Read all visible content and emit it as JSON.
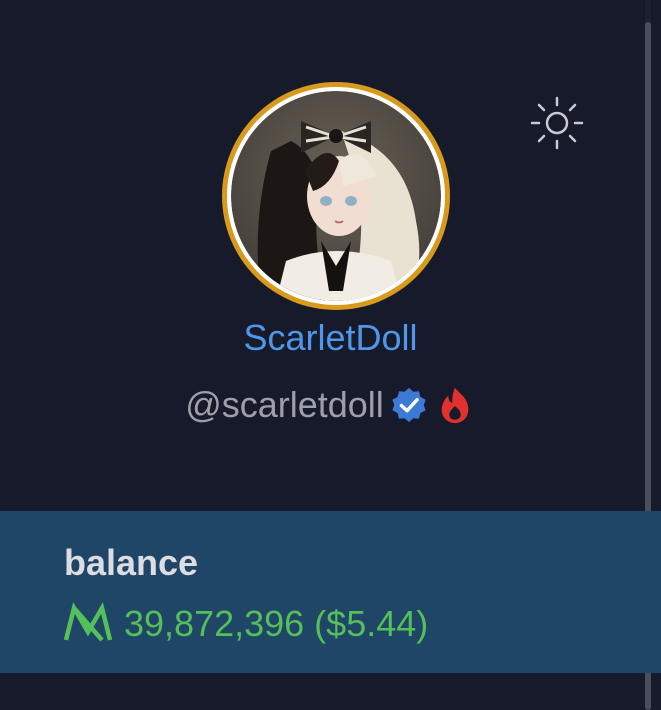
{
  "profile": {
    "display_name": "ScarletDoll",
    "handle": "@scarletdoll",
    "avatar_icon": "profile-portrait",
    "avatar_ring_color": "#d89a1d",
    "badges": [
      {
        "icon": "verified-badge-icon",
        "color": "#3d7ad6"
      },
      {
        "icon": "flame-badge-icon",
        "color": "#e0312f"
      }
    ]
  },
  "header": {
    "theme_toggle_icon": "sun-icon"
  },
  "balance": {
    "title": "balance",
    "currency_icon": "mana-logo-icon",
    "amount_text": "39,872,396 ($5.44)",
    "value_color": "#55bf5a"
  },
  "colors": {
    "background": "#171a2b",
    "accent_blue": "#4f97e8",
    "balance_panel": "#1f4567"
  }
}
